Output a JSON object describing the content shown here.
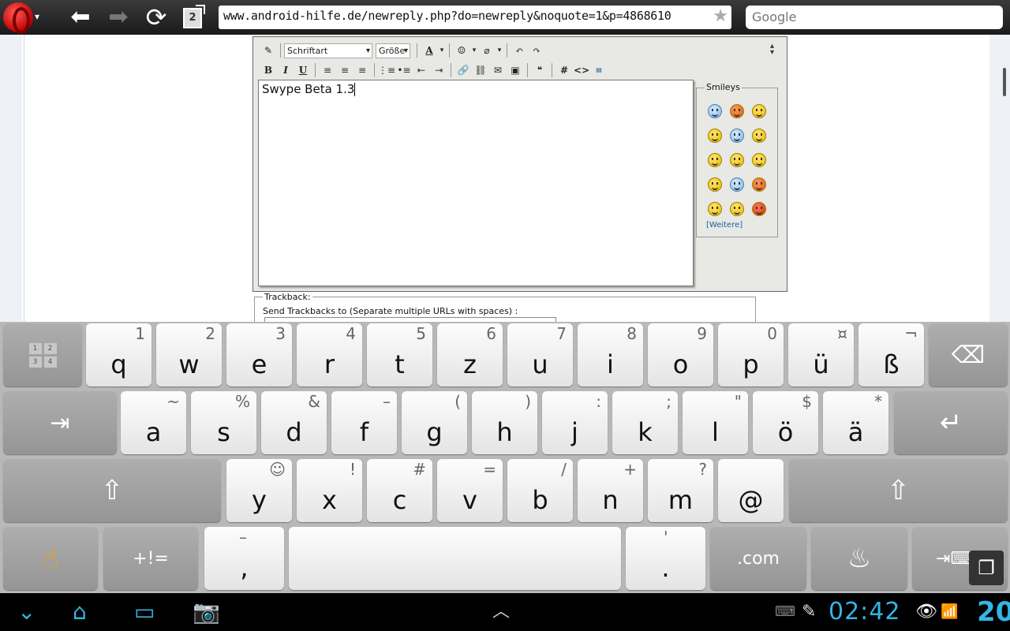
{
  "browser": {
    "tab_count": "2",
    "url": "www.android-hilfe.de/newreply.php?do=newreply&noquote=1&p=4868610",
    "search_placeholder": "Google"
  },
  "editor": {
    "font_select": "Schriftart",
    "size_select": "Größe",
    "text": "Swype Beta 1.3",
    "smileys_title": "Smileys",
    "smileys_more": "[Weitere]"
  },
  "trackback": {
    "legend": "Trackback:",
    "label": "Send Trackbacks to (Separate multiple URLs with spaces) :"
  },
  "keyboard": {
    "row1": [
      {
        "k": "q",
        "a": "1"
      },
      {
        "k": "w",
        "a": "2"
      },
      {
        "k": "e",
        "a": "3"
      },
      {
        "k": "r",
        "a": "4"
      },
      {
        "k": "t",
        "a": "5"
      },
      {
        "k": "z",
        "a": "6"
      },
      {
        "k": "u",
        "a": "7"
      },
      {
        "k": "i",
        "a": "8"
      },
      {
        "k": "o",
        "a": "9"
      },
      {
        "k": "p",
        "a": "0"
      },
      {
        "k": "ü",
        "a": "¤"
      },
      {
        "k": "ß",
        "a": "¬"
      }
    ],
    "row2": [
      {
        "k": "a",
        "a": "~"
      },
      {
        "k": "s",
        "a": "%"
      },
      {
        "k": "d",
        "a": "&"
      },
      {
        "k": "f",
        "a": "–"
      },
      {
        "k": "g",
        "a": "("
      },
      {
        "k": "h",
        "a": ")"
      },
      {
        "k": "j",
        "a": ":"
      },
      {
        "k": "k",
        "a": ";"
      },
      {
        "k": "l",
        "a": "\""
      },
      {
        "k": "ö",
        "a": "$"
      },
      {
        "k": "ä",
        "a": "*"
      }
    ],
    "row3": [
      {
        "k": "y",
        "a": "☺"
      },
      {
        "k": "x",
        "a": "!"
      },
      {
        "k": "c",
        "a": "#"
      },
      {
        "k": "v",
        "a": "="
      },
      {
        "k": "b",
        "a": "/"
      },
      {
        "k": "n",
        "a": "+"
      },
      {
        "k": "m",
        "a": "?"
      },
      {
        "k": "@",
        "a": ""
      }
    ],
    "numpad_keys": [
      "1",
      "2",
      "3",
      "4"
    ],
    "symbols_label": "+!=",
    "comma": {
      "k": ",",
      "a": "–"
    },
    "period": {
      "k": ".",
      "a": "'"
    },
    "dotcom_label": ".com"
  },
  "system": {
    "clock": "02:42",
    "battery": "20"
  },
  "colors": {
    "accent": "#33b5e5",
    "key_light": "#f2f2f2",
    "key_dark": "#a3a3a3"
  }
}
